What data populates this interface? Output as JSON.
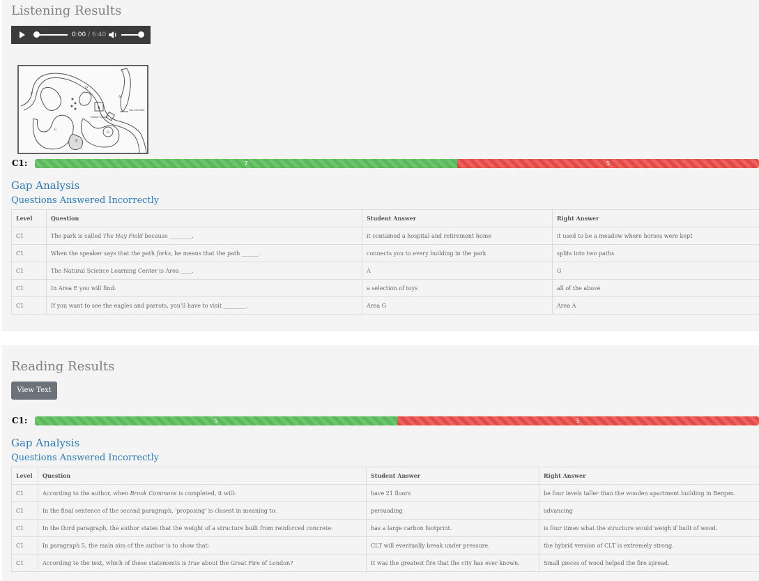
{
  "listening": {
    "title": "Listening Results",
    "audio": {
      "current_time": "0:00",
      "duration": " / 6:40",
      "progress": 0,
      "volume": 0.85
    },
    "map": {
      "labels": {
        "a": "A",
        "b": "B",
        "c": "C",
        "d": "D",
        "e": "E",
        "f": "F",
        "g": "G"
      },
      "visitor_center": "Visitor Center",
      "you_are_here": "You are here"
    },
    "score": {
      "level_label": "C1:",
      "correct": "7",
      "incorrect": "5",
      "correct_value": 7,
      "incorrect_value": 5
    },
    "gap_title": "Gap Analysis",
    "gap_subtitle": "Questions Answered Incorrectly",
    "columns": [
      "Level",
      "Question",
      "Student Answer",
      "Right Answer"
    ],
    "rows": [
      {
        "level": "C1",
        "q_pre": "The park is called ",
        "q_em": "The Hay Field",
        "q_post": " because ________.",
        "student": "it contained a hospital and retirement home",
        "right": "it used to be a meadow where horses were kept"
      },
      {
        "level": "C1",
        "q_pre": "When the speaker says that the path ",
        "q_em": "forks",
        "q_post": ", he means that the path ______.",
        "student": "connects you to every building in the park",
        "right": "splits into two paths"
      },
      {
        "level": "C1",
        "q_pre": "The Natural Science Learning Center is Area ____.",
        "q_em": "",
        "q_post": "",
        "student": "A",
        "right": "G"
      },
      {
        "level": "C1",
        "q_pre": "In Area E you will find:",
        "q_em": "",
        "q_post": "",
        "student": "a selection of toys",
        "right": "all of the above"
      },
      {
        "level": "C1",
        "q_pre": "If you want to see the eagles and parrots, you'll have to visit ________.",
        "q_em": "",
        "q_post": "",
        "student": "Area G",
        "right": "Area A"
      }
    ]
  },
  "reading": {
    "title": "Reading Results",
    "view_text_button": "View Text",
    "score": {
      "level_label": "C1:",
      "correct": "5",
      "incorrect": "5",
      "correct_value": 5,
      "incorrect_value": 5
    },
    "gap_title": "Gap Analysis",
    "gap_subtitle": "Questions Answered Incorrectly",
    "columns": [
      "Level",
      "Question",
      "Student Answer",
      "Right Answer"
    ],
    "rows": [
      {
        "level": "C1",
        "q_pre": "According to the author, when ",
        "q_em": "Brook Commons",
        "q_post": " is completed, it will:",
        "student": "have 21 floors",
        "right": "be four levels taller than the wooden apartment building in Bergen."
      },
      {
        "level": "C1",
        "q_pre": "In the final sentence of the second paragraph, 'proposing' is closest in meaning to:",
        "q_em": "",
        "q_post": "",
        "student": "persuading",
        "right": "advancing"
      },
      {
        "level": "C1",
        "q_pre": "In the third paragraph, the author states that the weight of a structure built from reinforced concrete:",
        "q_em": "",
        "q_post": "",
        "student": "has a large carbon footprint.",
        "right": "is four times what the structure would weigh if built of wood."
      },
      {
        "level": "C1",
        "q_pre": "In paragraph 5, the main aim of the author is to show that:",
        "q_em": "",
        "q_post": "",
        "student": "CLT will eventually break under pressure.",
        "right": "the hybrid version of CLT is extremely strong."
      },
      {
        "level": "C1",
        "q_pre": "According to the text, which of these statements is ",
        "q_em": "true",
        "q_post": " about the Great Fire of London?",
        "student": "It was the greatest fire that the city has ever known.",
        "right": "Small pieces of wood helped the fire spread."
      }
    ]
  }
}
